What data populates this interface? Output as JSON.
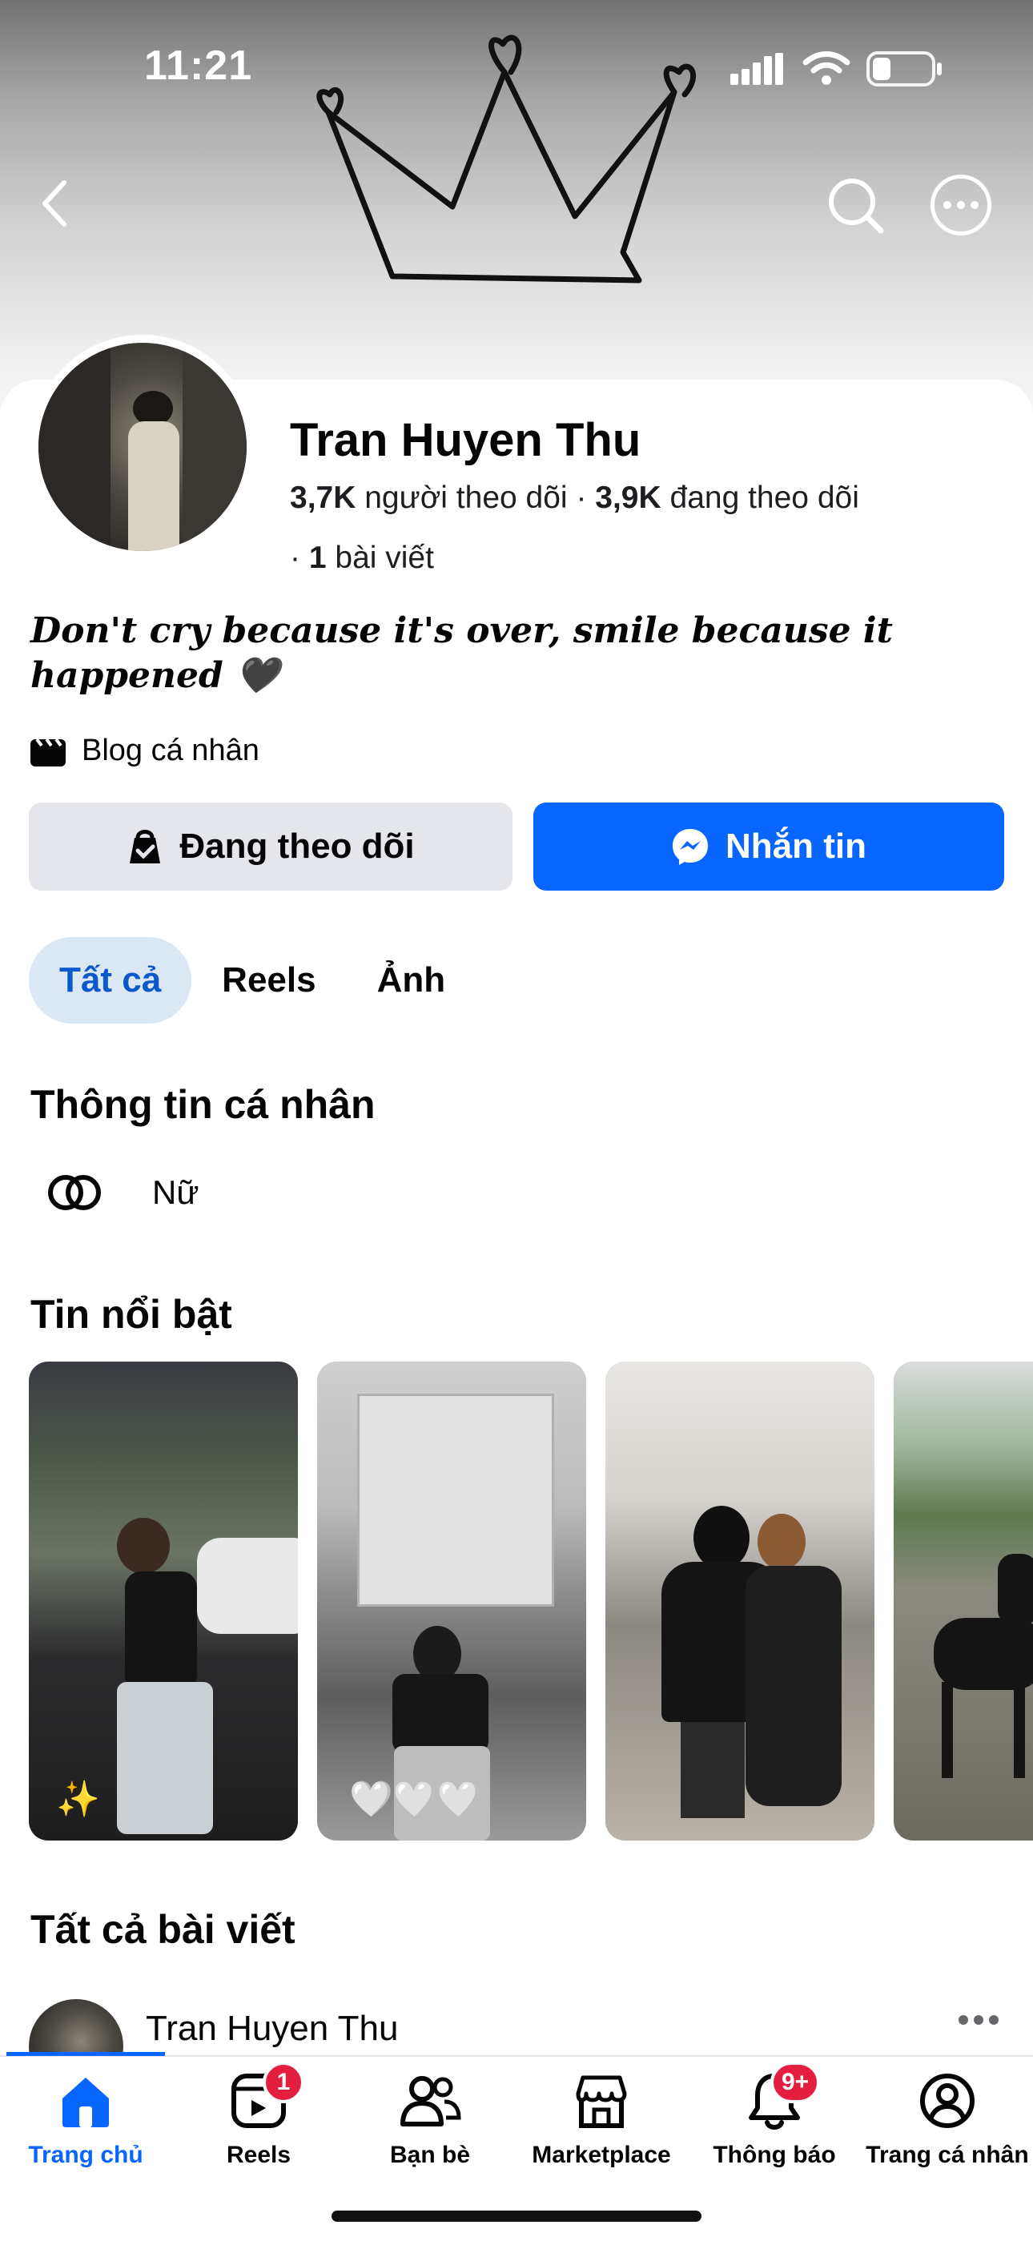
{
  "status_bar": {
    "time": "11:21"
  },
  "profile": {
    "name": "Tran Huyen Thu",
    "followers_count": "3,7K",
    "followers_label": "người theo dõi",
    "following_count": "3,9K",
    "following_label": "đang theo dõi",
    "posts_count": "1",
    "posts_label": "bài viết",
    "bio": "Don't cry because it's over, smile because it happened 🖤",
    "category": "Blog cá nhân"
  },
  "actions": {
    "follow_label": "Đang theo dõi",
    "message_label": "Nhắn tin"
  },
  "tabs": [
    {
      "label": "Tất cả",
      "active": true
    },
    {
      "label": "Reels",
      "active": false
    },
    {
      "label": "Ảnh",
      "active": false
    }
  ],
  "personal_info": {
    "title": "Thông tin cá nhân",
    "gender": "Nữ"
  },
  "highlights": {
    "title": "Tin nổi bật",
    "items": [
      {
        "caption": "✨"
      },
      {
        "caption": "🤍🤍🤍"
      },
      {
        "caption": ""
      },
      {
        "caption": ""
      }
    ]
  },
  "posts": {
    "title": "Tất cả bài viết",
    "first_author": "Tran Huyen Thu"
  },
  "bottom_nav": {
    "items": [
      {
        "label": "Trang chủ",
        "active": true,
        "badge": ""
      },
      {
        "label": "Reels",
        "active": false,
        "badge": "1"
      },
      {
        "label": "Bạn bè",
        "active": false,
        "badge": ""
      },
      {
        "label": "Marketplace",
        "active": false,
        "badge": ""
      },
      {
        "label": "Thông báo",
        "active": false,
        "badge": "9+"
      },
      {
        "label": "Trang cá nhân",
        "active": false,
        "badge": ""
      }
    ]
  },
  "colors": {
    "accent": "#0866ff",
    "badge": "#e41e3f",
    "tab_active_bg": "#dbe7f2"
  }
}
